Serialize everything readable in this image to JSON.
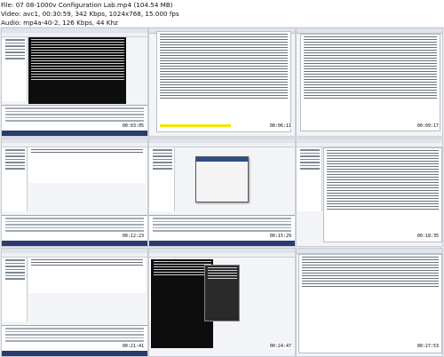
{
  "header": {
    "file_line": "File: 07 08-1000v Configuration Lab.mp4 (104.54 MB)",
    "video_line": "Video: avc1, 00:30:59, 342 Kbps, 1024x768, 15.000 fps",
    "audio_line": "Audio: mp4a-40-2, 126 Kbps, 44 Khz"
  },
  "thumbnails": [
    {
      "timestamp": "00:03:05"
    },
    {
      "timestamp": "00:06:11"
    },
    {
      "timestamp": "00:09:17"
    },
    {
      "timestamp": "00:12:23"
    },
    {
      "timestamp": "00:15:29"
    },
    {
      "timestamp": "00:18:35"
    },
    {
      "timestamp": "00:21:41"
    },
    {
      "timestamp": "00:24:47"
    },
    {
      "timestamp": "00:27:53"
    }
  ]
}
